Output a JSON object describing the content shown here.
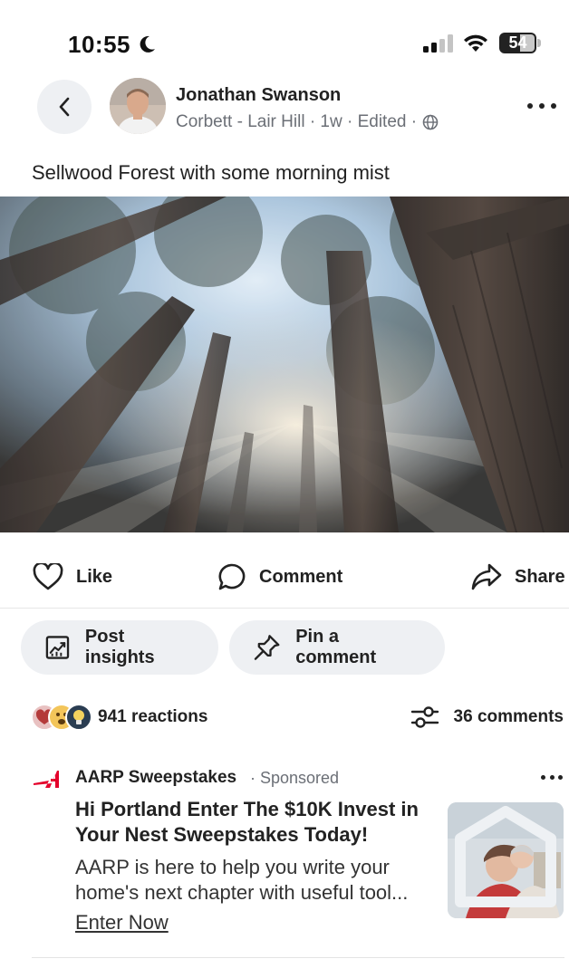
{
  "status_bar": {
    "time": "10:55",
    "battery_level": "54",
    "icons": [
      "moon-icon",
      "signal-icon",
      "wifi-icon",
      "battery-icon"
    ]
  },
  "post": {
    "author": "Jonathan Swanson",
    "meta": "Corbett - Lair Hill · 1w · Edited ·",
    "text": "Sellwood Forest with some morning mist",
    "image_subject": "forest canopy with mist"
  },
  "actions": {
    "like": "Like",
    "comment": "Comment",
    "share": "Share"
  },
  "chips": {
    "insights": "Post insights",
    "pin": "Pin a comment"
  },
  "stats": {
    "reactions": "941 reactions",
    "comments": "36 comments"
  },
  "ad": {
    "brand": "AARP Sweepstakes",
    "sponsored": "· Sponsored",
    "headline": "Hi Portland Enter The $10K Invest in Your Nest Sweepstakes Today!",
    "body_line1": "AARP is here to help you write your",
    "body_line2": "home's next chapter with useful tool...",
    "cta": "Enter Now",
    "brand_color": "#e4002b"
  }
}
